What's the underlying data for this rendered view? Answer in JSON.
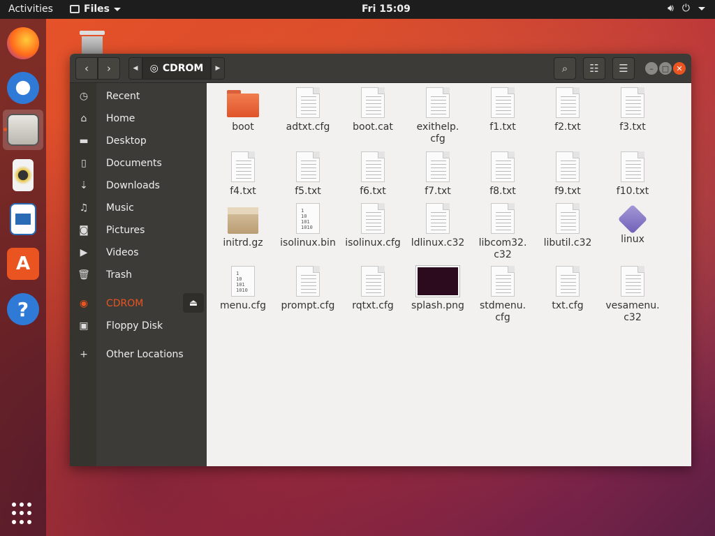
{
  "topbar": {
    "activities": "Activities",
    "app_menu": "Files",
    "clock": "Fri 15:09"
  },
  "window": {
    "path_label": "CDROM"
  },
  "sidebar": {
    "items": [
      {
        "label": "Recent",
        "icon": "clock-icon"
      },
      {
        "label": "Home",
        "icon": "home-icon"
      },
      {
        "label": "Desktop",
        "icon": "folder-icon"
      },
      {
        "label": "Documents",
        "icon": "document-icon"
      },
      {
        "label": "Downloads",
        "icon": "download-icon"
      },
      {
        "label": "Music",
        "icon": "music-icon"
      },
      {
        "label": "Pictures",
        "icon": "camera-icon"
      },
      {
        "label": "Videos",
        "icon": "video-icon"
      },
      {
        "label": "Trash",
        "icon": "trash-icon"
      },
      {
        "label": "CDROM",
        "icon": "disc-icon"
      },
      {
        "label": "Floppy Disk",
        "icon": "floppy-icon"
      },
      {
        "label": "Other Locations",
        "icon": "plus-icon"
      }
    ]
  },
  "files": [
    {
      "name": "boot",
      "type": "folder"
    },
    {
      "name": "adtxt.cfg",
      "type": "text"
    },
    {
      "name": "boot.cat",
      "type": "text"
    },
    {
      "name": "exithelp.\ncfg",
      "type": "text"
    },
    {
      "name": "f1.txt",
      "type": "text"
    },
    {
      "name": "f2.txt",
      "type": "text"
    },
    {
      "name": "f3.txt",
      "type": "text"
    },
    {
      "name": "f4.txt",
      "type": "text"
    },
    {
      "name": "f5.txt",
      "type": "text"
    },
    {
      "name": "f6.txt",
      "type": "text"
    },
    {
      "name": "f7.txt",
      "type": "text"
    },
    {
      "name": "f8.txt",
      "type": "text"
    },
    {
      "name": "f9.txt",
      "type": "text"
    },
    {
      "name": "f10.txt",
      "type": "text"
    },
    {
      "name": "initrd.gz",
      "type": "archive"
    },
    {
      "name": "isolinux.bin",
      "type": "binary"
    },
    {
      "name": "isolinux.cfg",
      "type": "text"
    },
    {
      "name": "ldlinux.c32",
      "type": "text"
    },
    {
      "name": "libcom32.\nc32",
      "type": "text"
    },
    {
      "name": "libutil.c32",
      "type": "text"
    },
    {
      "name": "linux",
      "type": "executable"
    },
    {
      "name": "menu.cfg",
      "type": "binary"
    },
    {
      "name": "prompt.cfg",
      "type": "text"
    },
    {
      "name": "rqtxt.cfg",
      "type": "text"
    },
    {
      "name": "splash.png",
      "type": "image"
    },
    {
      "name": "stdmenu.\ncfg",
      "type": "text"
    },
    {
      "name": "txt.cfg",
      "type": "text"
    },
    {
      "name": "vesamenu.\nc32",
      "type": "text"
    }
  ],
  "binary_icon_text": "1\n10\n101\n1010",
  "colors": {
    "accent": "#e95420",
    "headerbar": "#3c3b37",
    "content_bg": "#f2f1f0"
  },
  "dock": [
    "firefox-icon",
    "thunderbird-icon",
    "files-icon",
    "rhythmbox-icon",
    "writer-icon",
    "software-icon",
    "help-icon"
  ]
}
